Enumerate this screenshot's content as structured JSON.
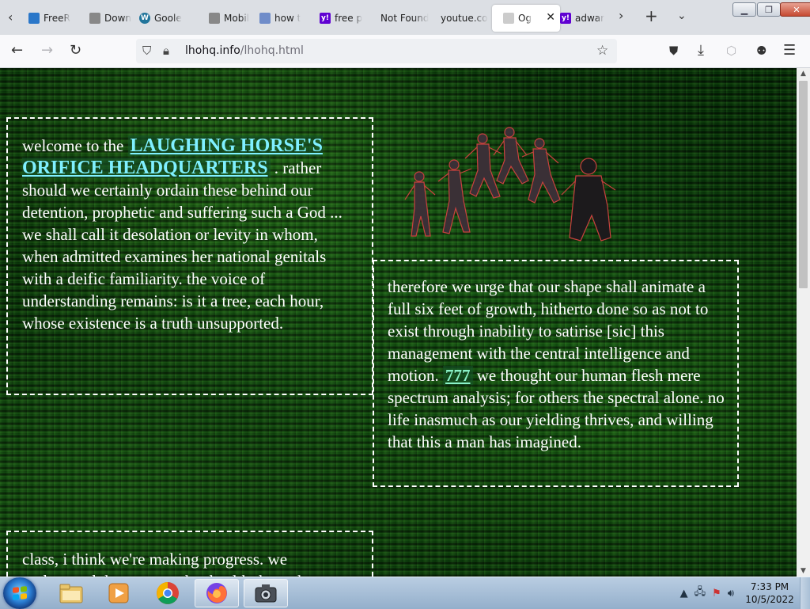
{
  "browser": {
    "tabs": [
      {
        "title": "FreeR",
        "icon": "page-icon",
        "icon_color": "#2a77c9"
      },
      {
        "title": "Down",
        "icon": "page-icon",
        "icon_color": "#888888"
      },
      {
        "title": "Goole",
        "icon": "wordpress-icon",
        "icon_color": "#21759b"
      },
      {
        "title": "Mobil",
        "icon": "page-icon",
        "icon_color": "#888888"
      },
      {
        "title": "how t",
        "icon": "page-icon",
        "icon_color": "#6f8cc9"
      },
      {
        "title": "free p",
        "icon": "yahoo-icon",
        "icon_color": "#6001d2"
      },
      {
        "title": "Not Found",
        "icon": "",
        "icon_color": ""
      },
      {
        "title": "youtue.co",
        "icon": "",
        "icon_color": ""
      },
      {
        "title": "Og",
        "icon": "page-icon",
        "icon_color": "#cccccc",
        "active": true
      },
      {
        "title": "adwar",
        "icon": "yahoo-icon",
        "icon_color": "#6001d2"
      }
    ],
    "url_host": "lhohq.info",
    "url_path": "/lhohq.html"
  },
  "page": {
    "box1": {
      "intro": "welcome to the ",
      "link": "LAUGHING HORSE'S ORIFICE HEADQUARTERS",
      "body": " . rather should we certainly ordain these behind our detention, prophetic and suffering such a God ... we shall call it desolation or levity in whom, when admitted examines her national genitals with a deific familiarity. the voice of understanding remains: is it a tree, each hour, whose existence is a truth unsupported."
    },
    "box2": {
      "text_before": "therefore we urge that our shape shall animate a full six feet of growth, hitherto done so as not to exist through inability to satirise [sic] this management with the central intelligence and motion. ",
      "link": "777",
      "text_after": " we thought our human flesh mere spectrum analysis; for others the spectral alone. no life inasmuch as our yielding thrives, and willing that this a man has imagined."
    },
    "box3": {
      "text": "class, i think we're making progress. we understood the concept that health through"
    },
    "image_alt": "dancing figures"
  },
  "taskbar": {
    "apps": [
      "explorer-icon",
      "media-player-icon",
      "chrome-icon",
      "firefox-icon",
      "camera-icon"
    ],
    "time": "7:33 PM",
    "date": "10/5/2022"
  },
  "colors": {
    "link": "#7ff0ff",
    "page_bg": "#062a08"
  }
}
